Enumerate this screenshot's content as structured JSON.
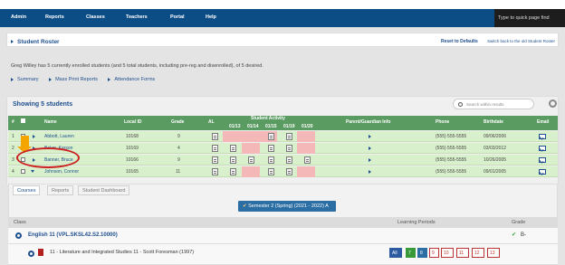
{
  "nav": {
    "items": [
      "Admin",
      "Reports",
      "Classes",
      "Teachers",
      "Portal",
      "Help"
    ],
    "search_placeholder": "Type to quick page find"
  },
  "roster": {
    "title": "Student Roster",
    "reset_label": "Reset to Defaults",
    "switch_label": "Switch back to the old Student Roster",
    "summary_text": "Greg Willey has 5 currently enrolled students (and 5 total students, including pre-reg and disenrolled), of 5 desired.",
    "links": [
      "Summary",
      "Mass Print Reports",
      "Attendance Forms"
    ]
  },
  "table": {
    "showing": "Showing 5 students",
    "search_placeholder": "Search within results",
    "headers": {
      "num": "#",
      "name": "Name",
      "local_id": "Local ID",
      "grade": "Grade",
      "al": "AL",
      "activity": "Student Activity",
      "parent": "Parent/Guardian Info",
      "phone": "Phone",
      "birthdate": "Birthdate",
      "email": "Email"
    },
    "activity_dates": [
      "01/13",
      "01/14",
      "01/15",
      "01/19",
      "01/20"
    ],
    "rows": [
      {
        "num": "1",
        "name": "Abbott, Lauren",
        "id": "10168",
        "grade": "9",
        "phone": "(555) 555-5555",
        "birthdate": "09/06/2006"
      },
      {
        "num": "2",
        "name": "Baker, Karson",
        "id": "10169",
        "grade": "4",
        "phone": "(555) 555-5555",
        "birthdate": "03/03/2012"
      },
      {
        "num": "3",
        "name": "Banner, Bruce",
        "id": "10166",
        "grade": "9",
        "phone": "(555) 555-5555",
        "birthdate": "10/26/2005"
      },
      {
        "num": "4",
        "name": "Johnson, Connor",
        "id": "10165",
        "grade": "11",
        "phone": "(555) 555-5555",
        "birthdate": "09/01/2005"
      }
    ]
  },
  "detail": {
    "tabs": [
      "Courses",
      "Reports",
      "Student Dashboard"
    ],
    "semester": "Semester 2 (Spring) (2021 - 2022) A",
    "class_header": "Class",
    "learning_periods_header": "Learning Periods",
    "grade_header": "Grade",
    "classes": [
      {
        "title": "English 11 (VPL.SKSL42.S2.10000)",
        "grade": "B-"
      },
      {
        "title": "11 - Literature and Integrated Studies 11 - Scott Foresman (1997)",
        "grade": ""
      }
    ],
    "periods": [
      "All",
      "7",
      "8",
      "9",
      "10",
      "11",
      "12",
      "13"
    ]
  },
  "colors": {
    "nav": "#0d4d86",
    "header_green": "#5a9b62",
    "row_green": "#d8f0cc",
    "pink": "#f5b8b8",
    "annotation_red": "#cc1f1f",
    "annotation_orange": "#f5a500"
  }
}
